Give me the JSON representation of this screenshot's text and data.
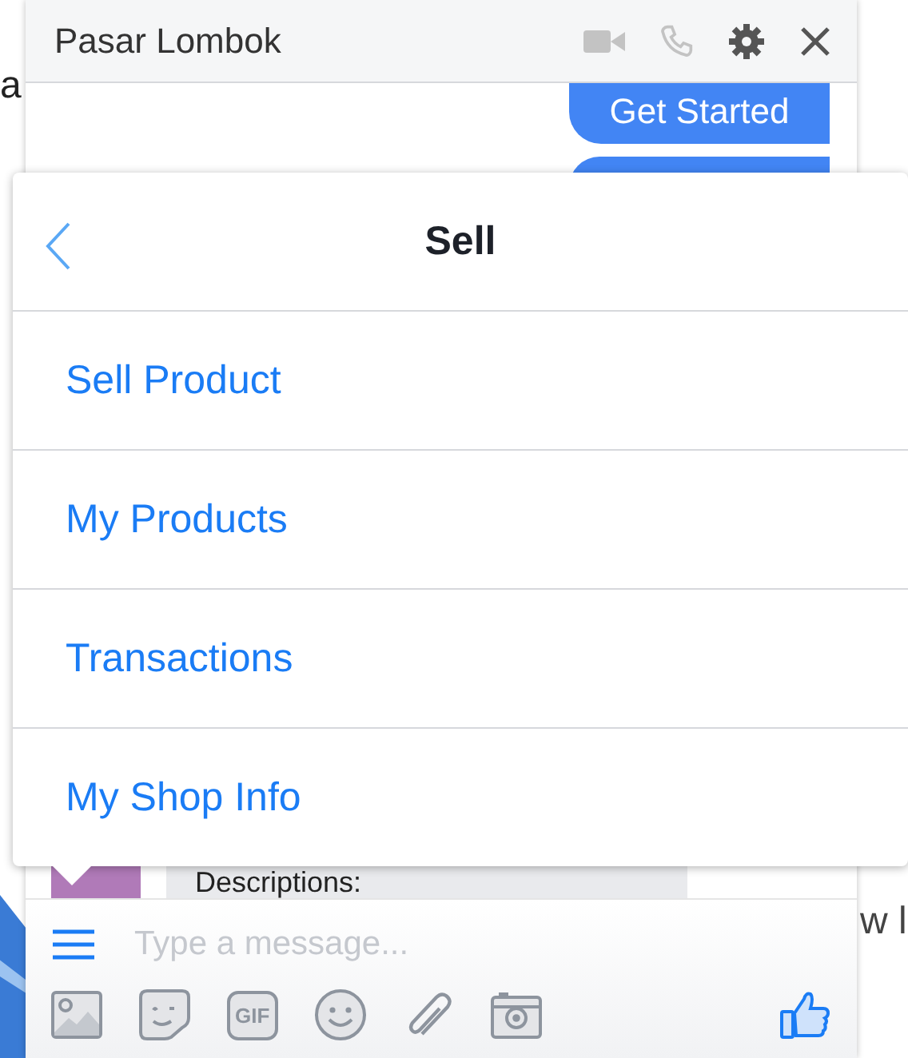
{
  "background_page": {
    "texts": [
      "a",
      "w l"
    ]
  },
  "chat": {
    "title": "Pasar Lombok",
    "messages": [
      {
        "kind": "outgoing",
        "text": "Get Started"
      },
      {
        "kind": "outgoing"
      },
      {
        "kind": "incoming",
        "text": "Descriptions:"
      }
    ],
    "composer": {
      "placeholder": "Type a message...",
      "gif_label": "GIF"
    }
  },
  "menu": {
    "title": "Sell",
    "items": [
      {
        "label": "Sell Product"
      },
      {
        "label": "My Products"
      },
      {
        "label": "Transactions"
      },
      {
        "label": "My Shop Info"
      }
    ]
  }
}
